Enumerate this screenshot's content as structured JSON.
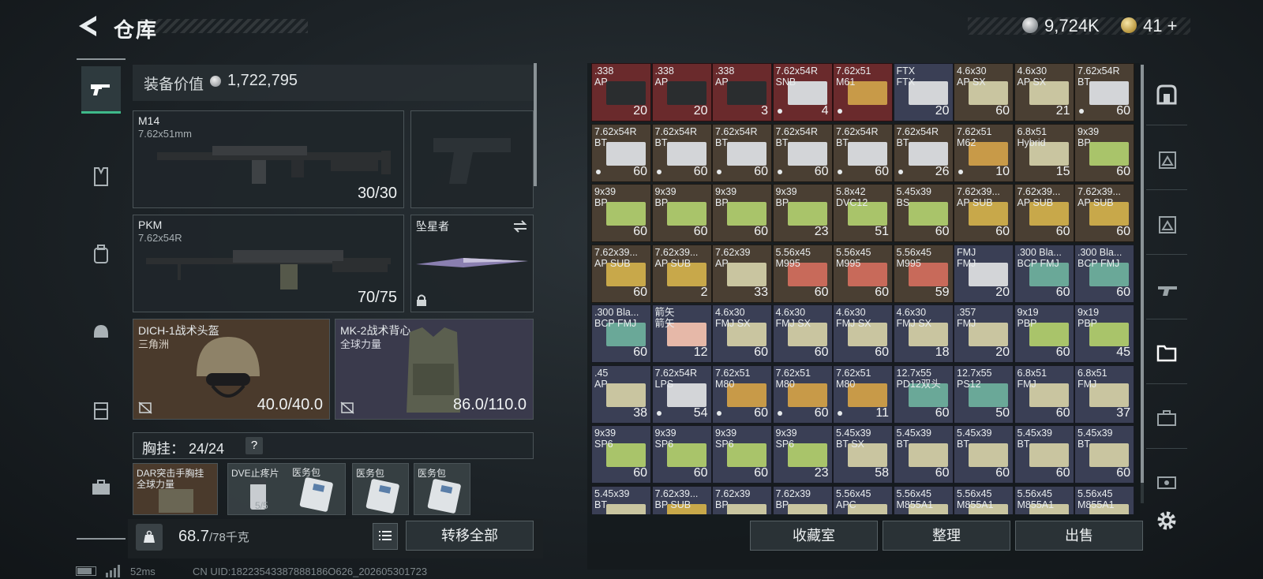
{
  "header": {
    "title": "仓库",
    "currency_silver": "9,724K",
    "currency_gold": "41",
    "currency_add": "+"
  },
  "left_nav": {
    "items": [
      "firearms-icon",
      "armor-icon",
      "backpack-icon",
      "helmet-icon",
      "vest-icon",
      "toolbox-icon"
    ]
  },
  "equipment": {
    "value_label": "装备价值",
    "value": "1,722,795",
    "primary": {
      "name": "M14",
      "caliber": "7.62x51mm",
      "ammo": "30/30"
    },
    "secondary": {
      "name": "PKM",
      "caliber": "7.62x54R",
      "ammo": "70/75"
    },
    "melee": {
      "name": "坠星者"
    },
    "helmet": {
      "name": "DICH-1战术头盔",
      "brand": "三角洲",
      "durability": "40.0/40.0"
    },
    "armor": {
      "name": "MK-2战术背心",
      "brand": "全球力量",
      "durability": "86.0/110.0"
    },
    "chest_rig": {
      "label": "胸挂：",
      "capacity": "24/24",
      "help": "?",
      "rig_name": "DAR突击手胸挂",
      "rig_brand": "全球力量",
      "items": [
        {
          "name": "DVE止疼片",
          "count": "5/5"
        },
        {
          "name": "医务包",
          "count": ""
        },
        {
          "name": "医务包",
          "count": ""
        },
        {
          "name": "医务包",
          "count": ""
        }
      ]
    }
  },
  "footer_left": {
    "weight_current": "68.7",
    "weight_max": "/78千克",
    "transfer_all": "转移全部"
  },
  "storage": {
    "rows": [
      [
        {
          "name": ".338\nAP",
          "count": "20",
          "color": "#6a2a2c",
          "dot": false
        },
        {
          "name": ".338\nAP",
          "count": "20",
          "color": "#6a2a2c",
          "dot": false
        },
        {
          "name": ".338\nAP",
          "count": "3",
          "color": "#6a2a2c",
          "dot": false
        },
        {
          "name": "7.62x54R\nSNB",
          "count": "4",
          "color": "#6a2a2c",
          "dot": true
        },
        {
          "name": "7.62x51\nM61",
          "count": "",
          "color": "#6a2a2c",
          "dot": true
        },
        {
          "name": "FTX\nFTX",
          "count": "20",
          "color": "#3a3f55",
          "dot": false
        },
        {
          "name": "4.6x30\nAP SX",
          "count": "60",
          "color": "#4a3f33",
          "dot": false
        },
        {
          "name": "4.6x30\nAP SX",
          "count": "21",
          "color": "#4a3f33",
          "dot": false
        },
        {
          "name": "7.62x54R\nBT",
          "count": "60",
          "color": "#4a3f33",
          "dot": true
        }
      ],
      [
        {
          "name": "7.62x54R\nBT",
          "count": "60",
          "color": "#4a3f33",
          "dot": true
        },
        {
          "name": "7.62x54R\nBT",
          "count": "60",
          "color": "#4a3f33",
          "dot": true
        },
        {
          "name": "7.62x54R\nBT",
          "count": "60",
          "color": "#4a3f33",
          "dot": true
        },
        {
          "name": "7.62x54R\nBT",
          "count": "60",
          "color": "#4a3f33",
          "dot": true
        },
        {
          "name": "7.62x54R\nBT",
          "count": "60",
          "color": "#4a3f33",
          "dot": true
        },
        {
          "name": "7.62x54R\nBT",
          "count": "26",
          "color": "#4a3f33",
          "dot": true
        },
        {
          "name": "7.62x51\nM62",
          "count": "10",
          "color": "#4a3f33",
          "dot": true
        },
        {
          "name": "6.8x51\nHybrid",
          "count": "15",
          "color": "#4a3f33",
          "dot": false
        },
        {
          "name": "9x39\nBP",
          "count": "60",
          "color": "#4a3f33",
          "dot": false
        }
      ],
      [
        {
          "name": "9x39\nBP",
          "count": "60",
          "color": "#4a3f33",
          "dot": false
        },
        {
          "name": "9x39\nBP",
          "count": "60",
          "color": "#4a3f33",
          "dot": false
        },
        {
          "name": "9x39\nBP",
          "count": "60",
          "color": "#4a3f33",
          "dot": false
        },
        {
          "name": "9x39\nBP",
          "count": "23",
          "color": "#4a3f33",
          "dot": false
        },
        {
          "name": "5.8x42\nDVC12",
          "count": "51",
          "color": "#4a3f33",
          "dot": false
        },
        {
          "name": "5.45x39\nBS",
          "count": "60",
          "color": "#4a3f33",
          "dot": false
        },
        {
          "name": "7.62x39...\nAP SUB",
          "count": "60",
          "color": "#4a3f33",
          "dot": false
        },
        {
          "name": "7.62x39...\nAP SUB",
          "count": "60",
          "color": "#4a3f33",
          "dot": false
        },
        {
          "name": "7.62x39...\nAP SUB",
          "count": "60",
          "color": "#4a3f33",
          "dot": false
        }
      ],
      [
        {
          "name": "7.62x39...\nAP SUB",
          "count": "60",
          "color": "#4a3f33",
          "dot": false
        },
        {
          "name": "7.62x39...\nAP SUB",
          "count": "2",
          "color": "#4a3f33",
          "dot": false
        },
        {
          "name": "7.62x39\nAP",
          "count": "33",
          "color": "#4a3f33",
          "dot": false
        },
        {
          "name": "5.56x45\nM995",
          "count": "60",
          "color": "#4a3f33",
          "dot": false
        },
        {
          "name": "5.56x45\nM995",
          "count": "60",
          "color": "#4a3f33",
          "dot": false
        },
        {
          "name": "5.56x45\nM995",
          "count": "59",
          "color": "#4a3f33",
          "dot": false
        },
        {
          "name": "FMJ\nFMJ",
          "count": "20",
          "color": "#3a3f55",
          "dot": false
        },
        {
          "name": ".300 Bla...\nBCP FMJ",
          "count": "60",
          "color": "#3a3f55",
          "dot": false
        },
        {
          "name": ".300 Bla...\nBCP FMJ",
          "count": "60",
          "color": "#3a3f55",
          "dot": false
        }
      ],
      [
        {
          "name": ".300 Bla...\nBCP FMJ",
          "count": "60",
          "color": "#3a3f55",
          "dot": false
        },
        {
          "name": "箭矢\n箭矢",
          "count": "12",
          "color": "#3a3f55",
          "dot": false
        },
        {
          "name": "4.6x30\nFMJ SX",
          "count": "60",
          "color": "#3a3f55",
          "dot": false
        },
        {
          "name": "4.6x30\nFMJ SX",
          "count": "60",
          "color": "#3a3f55",
          "dot": false
        },
        {
          "name": "4.6x30\nFMJ SX",
          "count": "60",
          "color": "#3a3f55",
          "dot": false
        },
        {
          "name": "4.6x30\nFMJ SX",
          "count": "18",
          "color": "#3a3f55",
          "dot": false
        },
        {
          "name": ".357\nFMJ",
          "count": "20",
          "color": "#3a3f55",
          "dot": false
        },
        {
          "name": "9x19\nPBP",
          "count": "60",
          "color": "#3a3f55",
          "dot": false
        },
        {
          "name": "9x19\nPBP",
          "count": "45",
          "color": "#3a3f55",
          "dot": false
        }
      ],
      [
        {
          "name": ".45\nAP",
          "count": "38",
          "color": "#3a3f55",
          "dot": false
        },
        {
          "name": "7.62x54R\nLPS",
          "count": "54",
          "color": "#3a3f55",
          "dot": true
        },
        {
          "name": "7.62x51\nM80",
          "count": "60",
          "color": "#3a3f55",
          "dot": true
        },
        {
          "name": "7.62x51\nM80",
          "count": "60",
          "color": "#3a3f55",
          "dot": true
        },
        {
          "name": "7.62x51\nM80",
          "count": "11",
          "color": "#3a3f55",
          "dot": true
        },
        {
          "name": "12.7x55\nPD12双头",
          "count": "60",
          "color": "#3a3f55",
          "dot": false
        },
        {
          "name": "12.7x55\nPS12",
          "count": "50",
          "color": "#3a3f55",
          "dot": false
        },
        {
          "name": "6.8x51\nFMJ",
          "count": "60",
          "color": "#3a3f55",
          "dot": false
        },
        {
          "name": "6.8x51\nFMJ",
          "count": "37",
          "color": "#3a3f55",
          "dot": false
        }
      ],
      [
        {
          "name": "9x39\nSP6",
          "count": "60",
          "color": "#3a3f55",
          "dot": false
        },
        {
          "name": "9x39\nSP6",
          "count": "60",
          "color": "#3a3f55",
          "dot": false
        },
        {
          "name": "9x39\nSP6",
          "count": "60",
          "color": "#3a3f55",
          "dot": false
        },
        {
          "name": "9x39\nSP6",
          "count": "23",
          "color": "#3a3f55",
          "dot": false
        },
        {
          "name": "5.45x39\nBT SX",
          "count": "58",
          "color": "#3a3f55",
          "dot": false
        },
        {
          "name": "5.45x39\nBT",
          "count": "60",
          "color": "#3a3f55",
          "dot": false
        },
        {
          "name": "5.45x39\nBT",
          "count": "60",
          "color": "#3a3f55",
          "dot": false
        },
        {
          "name": "5.45x39\nBT",
          "count": "60",
          "color": "#3a3f55",
          "dot": false
        },
        {
          "name": "5.45x39\nBT",
          "count": "60",
          "color": "#3a3f55",
          "dot": false
        }
      ],
      [
        {
          "name": "5.45x39\nBT",
          "count": "",
          "color": "#3a3f55",
          "dot": false
        },
        {
          "name": "7.62x39...\nBP SUB",
          "count": "",
          "color": "#3a3f55",
          "dot": false
        },
        {
          "name": "7.62x39\nBP",
          "count": "",
          "color": "#3a3f55",
          "dot": false
        },
        {
          "name": "7.62x39\nBP",
          "count": "",
          "color": "#3a3f55",
          "dot": false
        },
        {
          "name": "5.56x45\nAPC",
          "count": "",
          "color": "#3a3f55",
          "dot": false
        },
        {
          "name": "5.56x45\nM855A1",
          "count": "",
          "color": "#3a3f55",
          "dot": false
        },
        {
          "name": "5.56x45\nM855A1",
          "count": "",
          "color": "#3a3f55",
          "dot": false
        },
        {
          "name": "5.56x45\nM855A1",
          "count": "",
          "color": "#3a3f55",
          "dot": false
        },
        {
          "name": "5.56x45\nM855A1",
          "count": "",
          "color": "#3a3f55",
          "dot": false
        }
      ]
    ]
  },
  "footer_right": {
    "collection": "收藏室",
    "sort": "整理",
    "sell": "出售"
  },
  "right_nav": {
    "items": [
      "safebox-icon",
      "tier3-armor-icon",
      "tier3-box-icon",
      "tier3-gun-icon",
      "tier4-folder-icon",
      "tier3-case-icon",
      "tier4-case-icon"
    ]
  },
  "status": {
    "ping": "52ms",
    "uid": "CN UID:18223543387888186O626_202605301723"
  }
}
